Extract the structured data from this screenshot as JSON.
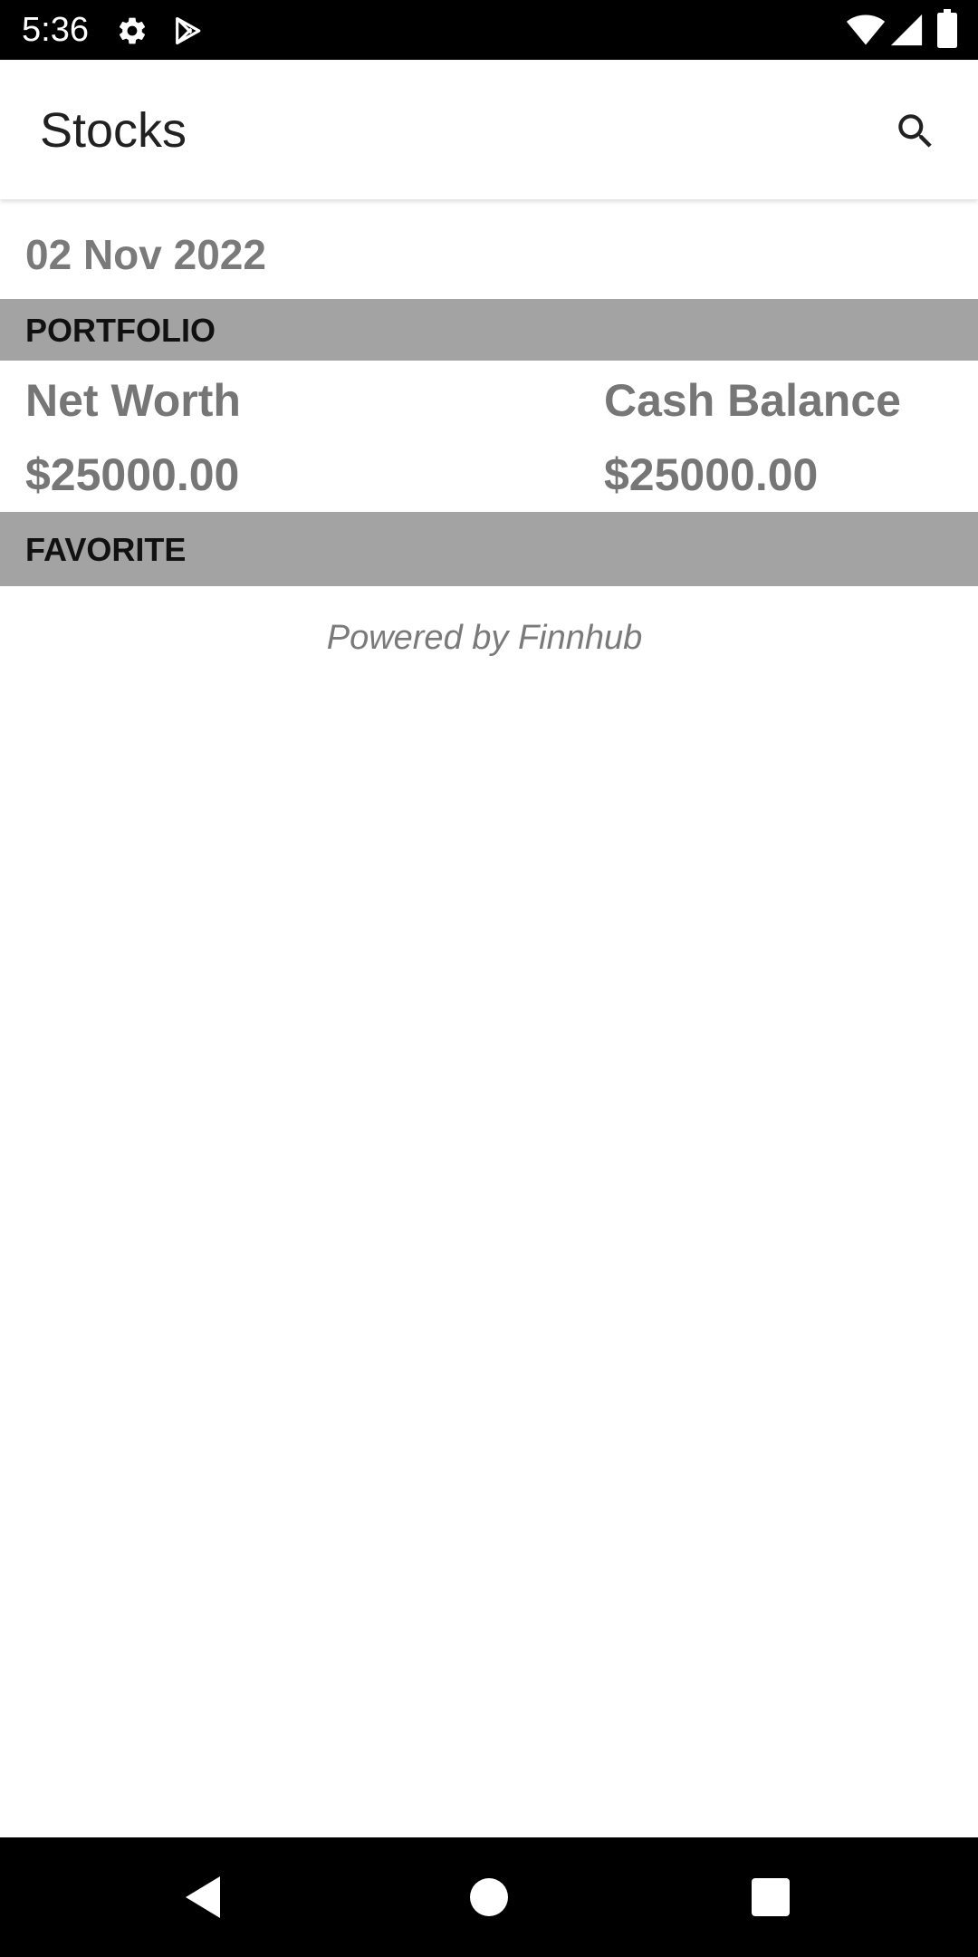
{
  "status_bar": {
    "time": "5:36",
    "icons": [
      "gear-icon",
      "play-store-icon",
      "wifi-icon",
      "cell-signal-icon",
      "battery-icon"
    ]
  },
  "app_bar": {
    "title": "Stocks",
    "search_icon": "search-icon"
  },
  "main": {
    "date": "02 Nov 2022",
    "portfolio": {
      "header": "PORTFOLIO",
      "net_worth_label": "Net Worth",
      "net_worth_value": "$25000.00",
      "cash_balance_label": "Cash Balance",
      "cash_balance_value": "$25000.00"
    },
    "favorite": {
      "header": "FAVORITE"
    },
    "footer": "Powered by Finnhub"
  },
  "nav_bar": {
    "icons": [
      "back-icon",
      "home-icon",
      "recents-icon"
    ]
  },
  "colors": {
    "section_header_bg": "#a3a3a3",
    "secondary_text": "#767676",
    "bars": "#000000"
  }
}
